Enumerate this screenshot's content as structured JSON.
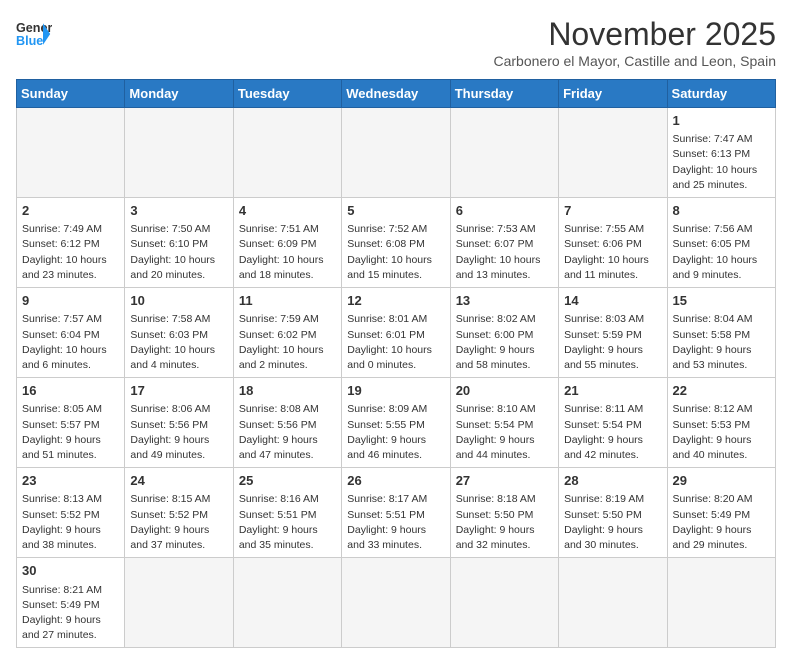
{
  "logo": {
    "line1": "General",
    "line2": "Blue"
  },
  "title": "November 2025",
  "location": "Carbonero el Mayor, Castille and Leon, Spain",
  "weekdays": [
    "Sunday",
    "Monday",
    "Tuesday",
    "Wednesday",
    "Thursday",
    "Friday",
    "Saturday"
  ],
  "weeks": [
    [
      {
        "day": "",
        "info": ""
      },
      {
        "day": "",
        "info": ""
      },
      {
        "day": "",
        "info": ""
      },
      {
        "day": "",
        "info": ""
      },
      {
        "day": "",
        "info": ""
      },
      {
        "day": "",
        "info": ""
      },
      {
        "day": "1",
        "info": "Sunrise: 7:47 AM\nSunset: 6:13 PM\nDaylight: 10 hours and 25 minutes."
      }
    ],
    [
      {
        "day": "2",
        "info": "Sunrise: 7:49 AM\nSunset: 6:12 PM\nDaylight: 10 hours and 23 minutes."
      },
      {
        "day": "3",
        "info": "Sunrise: 7:50 AM\nSunset: 6:10 PM\nDaylight: 10 hours and 20 minutes."
      },
      {
        "day": "4",
        "info": "Sunrise: 7:51 AM\nSunset: 6:09 PM\nDaylight: 10 hours and 18 minutes."
      },
      {
        "day": "5",
        "info": "Sunrise: 7:52 AM\nSunset: 6:08 PM\nDaylight: 10 hours and 15 minutes."
      },
      {
        "day": "6",
        "info": "Sunrise: 7:53 AM\nSunset: 6:07 PM\nDaylight: 10 hours and 13 minutes."
      },
      {
        "day": "7",
        "info": "Sunrise: 7:55 AM\nSunset: 6:06 PM\nDaylight: 10 hours and 11 minutes."
      },
      {
        "day": "8",
        "info": "Sunrise: 7:56 AM\nSunset: 6:05 PM\nDaylight: 10 hours and 9 minutes."
      }
    ],
    [
      {
        "day": "9",
        "info": "Sunrise: 7:57 AM\nSunset: 6:04 PM\nDaylight: 10 hours and 6 minutes."
      },
      {
        "day": "10",
        "info": "Sunrise: 7:58 AM\nSunset: 6:03 PM\nDaylight: 10 hours and 4 minutes."
      },
      {
        "day": "11",
        "info": "Sunrise: 7:59 AM\nSunset: 6:02 PM\nDaylight: 10 hours and 2 minutes."
      },
      {
        "day": "12",
        "info": "Sunrise: 8:01 AM\nSunset: 6:01 PM\nDaylight: 10 hours and 0 minutes."
      },
      {
        "day": "13",
        "info": "Sunrise: 8:02 AM\nSunset: 6:00 PM\nDaylight: 9 hours and 58 minutes."
      },
      {
        "day": "14",
        "info": "Sunrise: 8:03 AM\nSunset: 5:59 PM\nDaylight: 9 hours and 55 minutes."
      },
      {
        "day": "15",
        "info": "Sunrise: 8:04 AM\nSunset: 5:58 PM\nDaylight: 9 hours and 53 minutes."
      }
    ],
    [
      {
        "day": "16",
        "info": "Sunrise: 8:05 AM\nSunset: 5:57 PM\nDaylight: 9 hours and 51 minutes."
      },
      {
        "day": "17",
        "info": "Sunrise: 8:06 AM\nSunset: 5:56 PM\nDaylight: 9 hours and 49 minutes."
      },
      {
        "day": "18",
        "info": "Sunrise: 8:08 AM\nSunset: 5:56 PM\nDaylight: 9 hours and 47 minutes."
      },
      {
        "day": "19",
        "info": "Sunrise: 8:09 AM\nSunset: 5:55 PM\nDaylight: 9 hours and 46 minutes."
      },
      {
        "day": "20",
        "info": "Sunrise: 8:10 AM\nSunset: 5:54 PM\nDaylight: 9 hours and 44 minutes."
      },
      {
        "day": "21",
        "info": "Sunrise: 8:11 AM\nSunset: 5:54 PM\nDaylight: 9 hours and 42 minutes."
      },
      {
        "day": "22",
        "info": "Sunrise: 8:12 AM\nSunset: 5:53 PM\nDaylight: 9 hours and 40 minutes."
      }
    ],
    [
      {
        "day": "23",
        "info": "Sunrise: 8:13 AM\nSunset: 5:52 PM\nDaylight: 9 hours and 38 minutes."
      },
      {
        "day": "24",
        "info": "Sunrise: 8:15 AM\nSunset: 5:52 PM\nDaylight: 9 hours and 37 minutes."
      },
      {
        "day": "25",
        "info": "Sunrise: 8:16 AM\nSunset: 5:51 PM\nDaylight: 9 hours and 35 minutes."
      },
      {
        "day": "26",
        "info": "Sunrise: 8:17 AM\nSunset: 5:51 PM\nDaylight: 9 hours and 33 minutes."
      },
      {
        "day": "27",
        "info": "Sunrise: 8:18 AM\nSunset: 5:50 PM\nDaylight: 9 hours and 32 minutes."
      },
      {
        "day": "28",
        "info": "Sunrise: 8:19 AM\nSunset: 5:50 PM\nDaylight: 9 hours and 30 minutes."
      },
      {
        "day": "29",
        "info": "Sunrise: 8:20 AM\nSunset: 5:49 PM\nDaylight: 9 hours and 29 minutes."
      }
    ],
    [
      {
        "day": "30",
        "info": "Sunrise: 8:21 AM\nSunset: 5:49 PM\nDaylight: 9 hours and 27 minutes."
      },
      {
        "day": "",
        "info": ""
      },
      {
        "day": "",
        "info": ""
      },
      {
        "day": "",
        "info": ""
      },
      {
        "day": "",
        "info": ""
      },
      {
        "day": "",
        "info": ""
      },
      {
        "day": "",
        "info": ""
      }
    ]
  ]
}
